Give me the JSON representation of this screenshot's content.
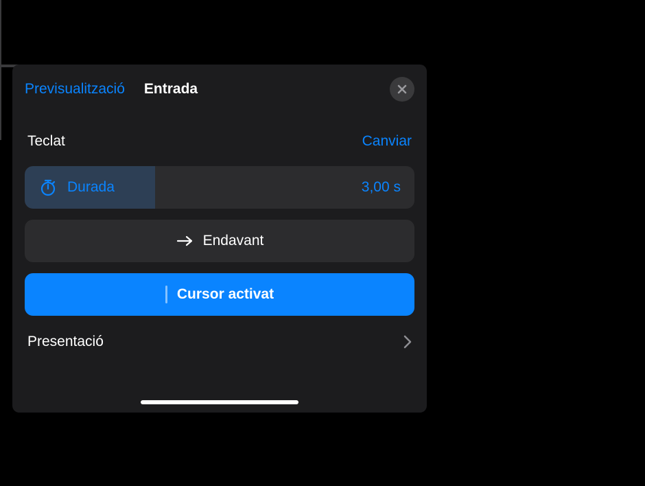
{
  "header": {
    "preview_label": "Previsualització",
    "title": "Entrada"
  },
  "section": {
    "label": "Teclat",
    "change_label": "Canviar"
  },
  "duration": {
    "label": "Durada",
    "value": "3,00 s"
  },
  "direction": {
    "label": "Endavant"
  },
  "cursor": {
    "label": "Cursor activat"
  },
  "footer": {
    "label": "Presentació"
  },
  "icons": {
    "close": "close-icon",
    "stopwatch": "stopwatch-icon",
    "arrow_right": "arrow-right-icon",
    "chevron_right": "chevron-right-icon"
  }
}
